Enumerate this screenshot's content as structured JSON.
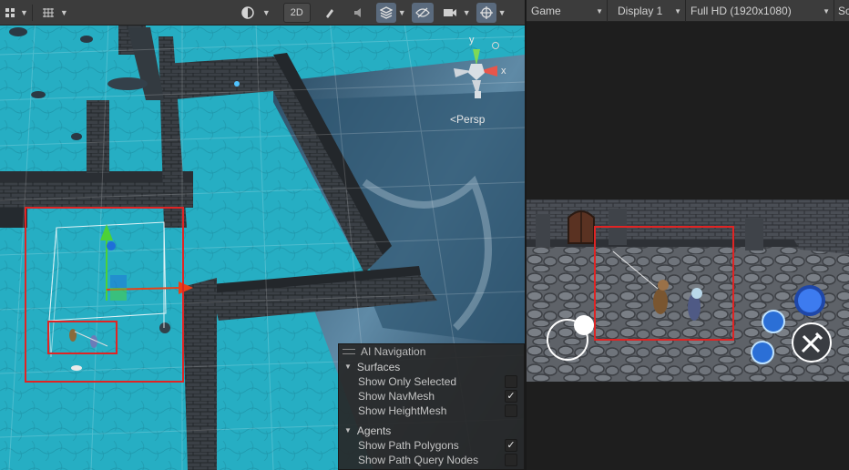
{
  "scene_view": {
    "toolbar": {
      "toggle_2d_label": "2D",
      "icons": [
        "draw-mode-icon",
        "grid-icon",
        "shading-mode-icon",
        "lighting-icon",
        "effects-icon",
        "audio-icon",
        "layers-icon",
        "visibility-icon",
        "camera-icon",
        "gizmos-icon"
      ]
    },
    "gizmo_axes": {
      "y": "y",
      "x": "x"
    },
    "projection_label": "Persp",
    "ai_navigation": {
      "title": "AI Navigation",
      "sections": [
        {
          "title": "Surfaces",
          "options": [
            {
              "label": "Show Only Selected",
              "checked": false
            },
            {
              "label": "Show NavMesh",
              "checked": true
            },
            {
              "label": "Show HeightMesh",
              "checked": false
            }
          ]
        },
        {
          "title": "Agents",
          "options": [
            {
              "label": "Show Path Polygons",
              "checked": true
            },
            {
              "label": "Show Path Query Nodes",
              "checked": false
            }
          ]
        }
      ]
    }
  },
  "game_view": {
    "tab_label": "Game",
    "display": "Display 1",
    "resolution": "Full HD (1920x1080)",
    "scale_truncated": "Sc"
  },
  "colors": {
    "highlight_box": "#e02424",
    "floor_cyan": "#2bb4c9",
    "toolbar_bg": "#3c3c3c"
  }
}
